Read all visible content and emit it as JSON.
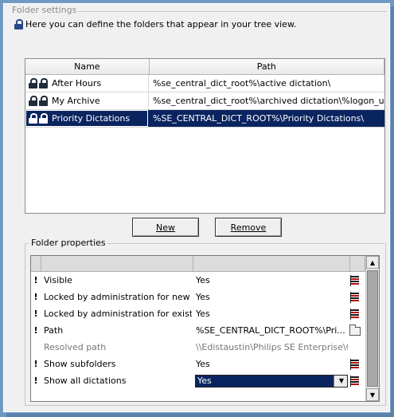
{
  "header": {
    "group_title": "Folder settings",
    "intro_text": "Here you can define the folders that appear in your tree view."
  },
  "folders": {
    "columns": [
      "Name",
      "Path"
    ],
    "rows": [
      {
        "name": "After Hours",
        "path": "%se_central_dict_root%\\active dictation\\",
        "selected": false
      },
      {
        "name": "My Archive",
        "path": "%se_central_dict_root%\\archived  dictation\\%logon_u...",
        "selected": false
      },
      {
        "name": "Priority Dictations",
        "path": "%SE_CENTRAL_DICT_ROOT%\\Priority Dictations\\",
        "selected": true
      }
    ]
  },
  "buttons": {
    "new_label": "New",
    "remove_label": "Remove"
  },
  "properties": {
    "group_title": "Folder properties",
    "rows": [
      {
        "mark": "!",
        "label": "Visible",
        "value": "Yes",
        "icon": "flag-icon"
      },
      {
        "mark": "!",
        "label": "Locked by administration for new us",
        "value": "Yes",
        "icon": "flag-icon"
      },
      {
        "mark": "!",
        "label": "Locked by administration for existin",
        "value": "Yes",
        "icon": "flag-icon"
      },
      {
        "mark": "!",
        "label": "Path",
        "value": "%SE_CENTRAL_DICT_ROOT%\\Pri...",
        "icon": "folder-icon"
      },
      {
        "mark": "",
        "label": "Resolved path",
        "value": "\\\\Edistaustin\\Philips SE Enterprise\\Ce",
        "icon": ""
      },
      {
        "mark": "!",
        "label": "Show subfolders",
        "value": "Yes",
        "icon": "flag-icon"
      },
      {
        "mark": "!",
        "label": "Show all dictations",
        "value": "Yes",
        "icon": "flag-icon"
      }
    ]
  },
  "colors": {
    "selection": "#0a2460",
    "frame_background": "#f0f0f0",
    "window_edge": "#6f99c3"
  }
}
